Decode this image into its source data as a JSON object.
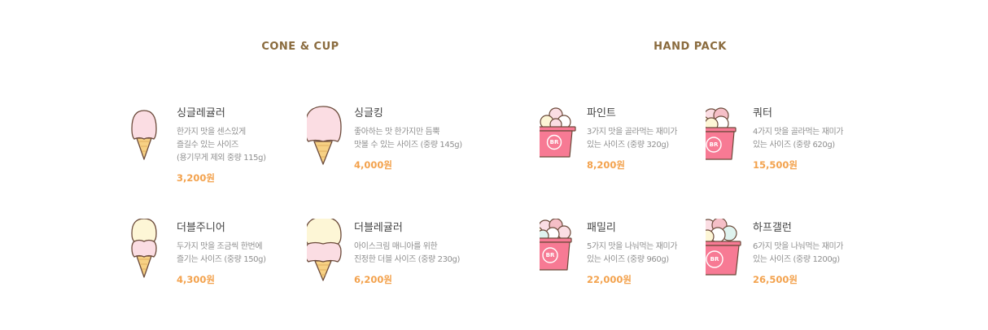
{
  "sections": {
    "cone_cup": {
      "title": "CONE & CUP"
    },
    "hand_pack": {
      "title": "HAND PACK"
    }
  },
  "products": {
    "single_regular": {
      "name": "싱글레귤러",
      "desc": "한가지 맛을 센스있게\n즐길수 있는 사이즈\n(용기무게 제외 중량 115g)",
      "price": "3,200원",
      "icon": "single-cone-icon"
    },
    "single_king": {
      "name": "싱글킹",
      "desc": "좋아하는 맛 한가지만 듬뿍\n맛볼 수 있는 사이즈 (중량 145g)",
      "price": "4,000원",
      "icon": "large-cone-icon"
    },
    "double_junior": {
      "name": "더블주니어",
      "desc": "두가지 맛을 조금씩 한번에\n즐기는 사이즈 (중량 150g)",
      "price": "4,300원",
      "icon": "double-cone-icon"
    },
    "double_regular": {
      "name": "더블레귤러",
      "desc": "아이스크림 매니아를 위한\n진정한 더블 사이즈 (중량 230g)",
      "price": "6,200원",
      "icon": "large-double-cone-icon"
    },
    "pint": {
      "name": "파인트",
      "desc": "3가지 맛을 골라먹는 재미가\n있는 사이즈 (중량 320g)",
      "price": "8,200원",
      "icon": "pint-cup-icon"
    },
    "quarter": {
      "name": "쿼터",
      "desc": "4가지 맛을 골라먹는 재미가\n있는 사이즈 (중량 620g)",
      "price": "15,500원",
      "icon": "quarter-cup-icon"
    },
    "family": {
      "name": "패밀리",
      "desc": "5가지 맛을 나눠먹는 재미가\n있는 사이즈 (중량 960g)",
      "price": "22,000원",
      "icon": "family-cup-icon"
    },
    "half_gallon": {
      "name": "하프갤런",
      "desc": "6가지 맛을 나눠먹는 재미가\n있는 사이즈 (중량 1200g)",
      "price": "26,500원",
      "icon": "half-gallon-cup-icon"
    }
  },
  "colors": {
    "title": "#8a6b3e",
    "price": "#f3a24d",
    "pink_scoop": "#fbdde3",
    "yellow_scoop": "#fdf6d6",
    "cone": "#f7d184",
    "cup": "#f77a94",
    "outline": "#6b4a3a"
  }
}
